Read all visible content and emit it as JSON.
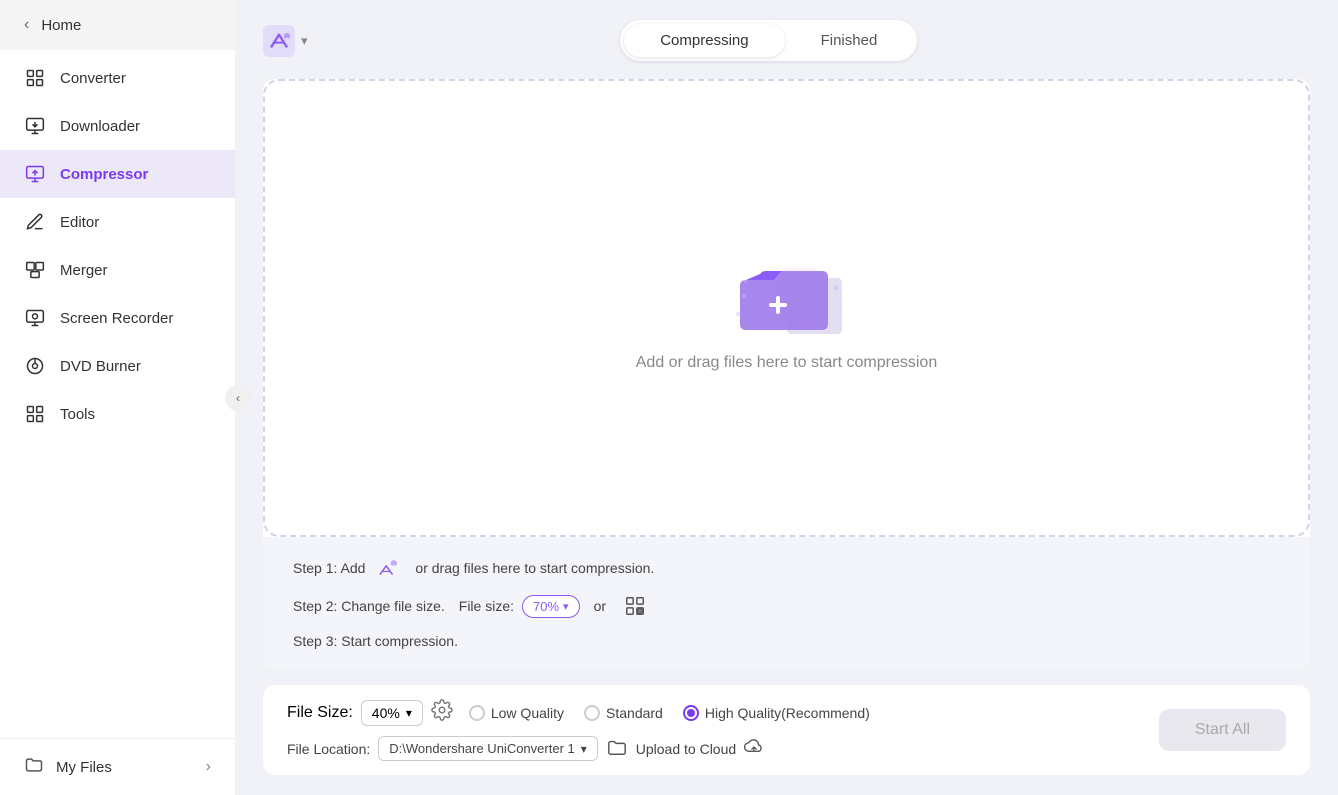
{
  "sidebar": {
    "home_label": "Home",
    "items": [
      {
        "id": "converter",
        "label": "Converter",
        "icon": "converter-icon"
      },
      {
        "id": "downloader",
        "label": "Downloader",
        "icon": "downloader-icon"
      },
      {
        "id": "compressor",
        "label": "Compressor",
        "icon": "compressor-icon",
        "active": true
      },
      {
        "id": "editor",
        "label": "Editor",
        "icon": "editor-icon"
      },
      {
        "id": "merger",
        "label": "Merger",
        "icon": "merger-icon"
      },
      {
        "id": "screen-recorder",
        "label": "Screen Recorder",
        "icon": "screen-recorder-icon"
      },
      {
        "id": "dvd-burner",
        "label": "DVD Burner",
        "icon": "dvd-burner-icon"
      },
      {
        "id": "tools",
        "label": "Tools",
        "icon": "tools-icon"
      }
    ],
    "my_files_label": "My Files"
  },
  "tabs": {
    "compressing_label": "Compressing",
    "finished_label": "Finished",
    "active": "compressing"
  },
  "drop_area": {
    "text": "Add or drag files here to start compression"
  },
  "steps": {
    "step1_prefix": "Step 1: Add",
    "step1_suffix": "or drag files here to start compression.",
    "step2_prefix": "Step 2: Change file size.",
    "step2_file_size_label": "File size:",
    "step2_percent": "70%",
    "step3": "Step 3: Start compression."
  },
  "footer": {
    "file_size_label": "File Size:",
    "file_size_value": "40%",
    "quality_options": [
      {
        "id": "low",
        "label": "Low Quality",
        "selected": false
      },
      {
        "id": "standard",
        "label": "Standard",
        "selected": false
      },
      {
        "id": "high",
        "label": "High Quality(Recommend)",
        "selected": true
      }
    ],
    "file_location_label": "File Location:",
    "file_location_value": "D:\\Wondershare UniConverter 1",
    "upload_cloud_label": "Upload to Cloud",
    "start_btn_label": "Start All"
  },
  "colors": {
    "accent": "#7c3aed",
    "accent_light": "#ede8f8"
  }
}
